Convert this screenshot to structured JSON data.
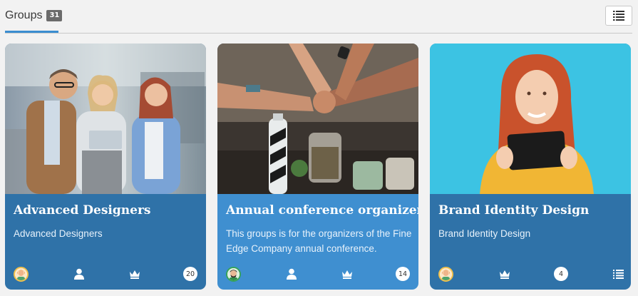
{
  "header": {
    "tab_label": "Groups",
    "group_count": "31",
    "view_toggle_icon": "list-view-icon",
    "accent_color": "#3a8dd0"
  },
  "cards": [
    {
      "title": "Advanced Designers",
      "description": "Advanced Designers",
      "image": "three-colleagues-with-tablet-photo",
      "owner_avatar": "owner-avatar-icon",
      "icons": [
        "member-icon",
        "crown-icon"
      ],
      "member_count": "20",
      "background": "#2f72a8"
    },
    {
      "title": "Annual conference organizers",
      "description": "This groups is for the organizers of the Fine Edge Company annual conference.",
      "image": "team-fist-bump-photo",
      "owner_avatar": "owner-avatar-icon",
      "icons": [
        "member-icon",
        "crown-icon"
      ],
      "member_count": "14",
      "background": "#3f8fd0"
    },
    {
      "title": "Brand Identity Design",
      "description": "Brand Identity Design",
      "image": "woman-holding-tablet-photo",
      "owner_avatar": "owner-avatar-icon",
      "icons": [
        "crown-icon",
        "list-icon"
      ],
      "member_count": "4",
      "background": "#2f72a8"
    }
  ]
}
